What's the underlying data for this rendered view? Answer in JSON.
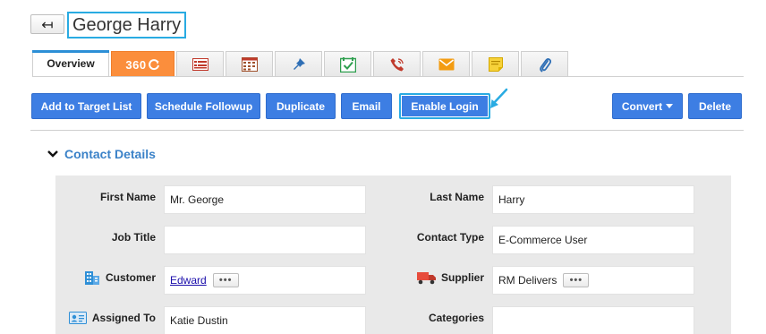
{
  "header": {
    "back_glyph": "↤",
    "title": "George Harry"
  },
  "tabs": [
    {
      "label": "Overview",
      "icon": ""
    },
    {
      "label": "360",
      "icon": "refresh-icon"
    },
    {
      "label": "",
      "icon": "invoice-icon"
    },
    {
      "label": "",
      "icon": "calendar-grid-icon"
    },
    {
      "label": "",
      "icon": "pin-icon"
    },
    {
      "label": "",
      "icon": "calendar-check-icon"
    },
    {
      "label": "",
      "icon": "phone-icon"
    },
    {
      "label": "",
      "icon": "mail-icon"
    },
    {
      "label": "",
      "icon": "sticky-note-icon"
    },
    {
      "label": "",
      "icon": "paperclip-icon"
    }
  ],
  "toolbar": {
    "add_to_target_list": "Add to Target List",
    "schedule_followup": "Schedule Followup",
    "duplicate": "Duplicate",
    "email": "Email",
    "enable_login": "Enable Login",
    "convert": "Convert",
    "delete": "Delete"
  },
  "section": {
    "title": "Contact Details"
  },
  "fields": {
    "first_name": {
      "label": "First Name",
      "value": "Mr. George"
    },
    "last_name": {
      "label": "Last Name",
      "value": "Harry"
    },
    "job_title": {
      "label": "Job Title",
      "value": ""
    },
    "contact_type": {
      "label": "Contact Type",
      "value": "E-Commerce User"
    },
    "customer": {
      "label": "Customer",
      "value": "Edward"
    },
    "supplier": {
      "label": "Supplier",
      "value": "RM Delivers"
    },
    "assigned_to": {
      "label": "Assigned To",
      "value": "Katie Dustin"
    },
    "categories": {
      "label": "Categories",
      "value": ""
    }
  },
  "more_glyph": "•••",
  "colors": {
    "accent": "#3d7ee3",
    "highlight": "#29abe2",
    "tab_360": "#fb8e3c",
    "section_title": "#3b82c8"
  }
}
